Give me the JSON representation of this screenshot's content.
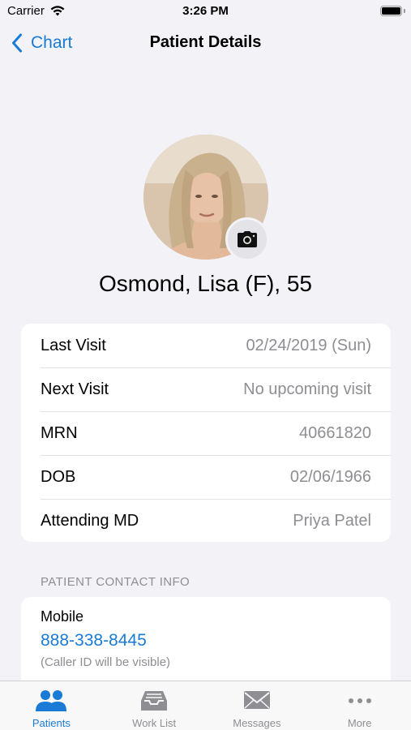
{
  "status_bar": {
    "carrier": "Carrier",
    "time": "3:26 PM"
  },
  "nav": {
    "back_label": "Chart",
    "title": "Patient Details"
  },
  "patient": {
    "name": "Osmond, Lisa (F), 55"
  },
  "details": [
    {
      "label": "Last Visit",
      "value": "02/24/2019 (Sun)"
    },
    {
      "label": "Next Visit",
      "value": "No upcoming visit"
    },
    {
      "label": "MRN",
      "value": "40661820"
    },
    {
      "label": "DOB",
      "value": "02/06/1966"
    },
    {
      "label": "Attending MD",
      "value": "Priya Patel"
    }
  ],
  "contact": {
    "section_header": "PATIENT CONTACT INFO",
    "label": "Mobile",
    "phone": "888-338-8445",
    "note": "(Caller ID will be visible)"
  },
  "tabs": [
    {
      "label": "Patients",
      "icon": "patients-icon",
      "active": true
    },
    {
      "label": "Work List",
      "icon": "inbox-tray-icon",
      "active": false
    },
    {
      "label": "Messages",
      "icon": "envelope-icon",
      "active": false
    },
    {
      "label": "More",
      "icon": "ellipsis-icon",
      "active": false
    }
  ],
  "colors": {
    "accent": "#1a7bd6",
    "background": "#f2f2f7",
    "secondary_text": "#8e8e93"
  }
}
